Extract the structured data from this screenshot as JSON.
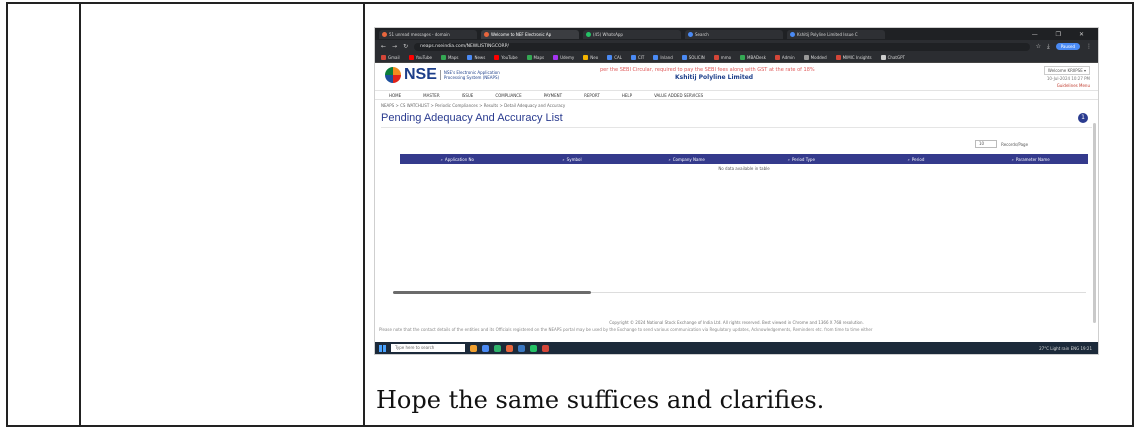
{
  "caption": "Hope the same suffices and clarifies.",
  "browser": {
    "tabs": [
      {
        "label": "51 unread messages - domain",
        "icon_color": "#e8663d",
        "active": false
      },
      {
        "label": "Welcome to NEF Electronic Ap",
        "icon_color": "#e8663d",
        "active": true
      },
      {
        "label": "(45) WhatsApp",
        "icon_color": "#25c266",
        "active": false
      },
      {
        "label": "Search",
        "icon_color": "#4a8af4",
        "active": false
      },
      {
        "label": "Kshitij Polyline Limited Issue C",
        "icon_color": "#4a8af4",
        "active": false
      }
    ],
    "window_controls": "— ❐ ✕",
    "url": "neaps.nseindia.com/NEWLISTINGCORP/",
    "profile_label": "Paused",
    "bookmarks": [
      {
        "label": "Gmail",
        "color": "#d44638"
      },
      {
        "label": "YouTube",
        "color": "#ff0000"
      },
      {
        "label": "Maps",
        "color": "#34a853"
      },
      {
        "label": "News",
        "color": "#4a8af4"
      },
      {
        "label": "YouTube",
        "color": "#ff0000"
      },
      {
        "label": "Maps",
        "color": "#34a853"
      },
      {
        "label": "Udemy",
        "color": "#a435f0"
      },
      {
        "label": "Neo",
        "color": "#f4b400"
      },
      {
        "label": "CAL",
        "color": "#4a8af4"
      },
      {
        "label": "CIT",
        "color": "#4a8af4"
      },
      {
        "label": "Inland",
        "color": "#4a8af4"
      },
      {
        "label": "SOLICIN",
        "color": "#4a8af4"
      },
      {
        "label": "mmo",
        "color": "#d44638"
      },
      {
        "label": "MBADesk",
        "color": "#34a853"
      },
      {
        "label": "Admin",
        "color": "#d44638"
      },
      {
        "label": "Modded",
        "color": "#999999"
      },
      {
        "label": "MIMIC Insights",
        "color": "#d44638"
      },
      {
        "label": "ChatGPT",
        "color": "#cccccc"
      }
    ]
  },
  "nse": {
    "logo_text": "NSE",
    "logo_subtitle_1": "NSE's Electronic Application",
    "logo_subtitle_2": "Processing System (NEAPS)",
    "marquee": "per the SEBI Circular, required to pay the SEBI fees along with GST at the rate of 18%",
    "company_name": "Kshitij Polyline Limited",
    "welcome": "Welcome KRIIPSE ▾",
    "datetime": "10-Jul-2024 10:27 PM",
    "guidelines": "Guidelines Menu",
    "menu": [
      "HOME",
      "MASTER",
      "ISSUE",
      "COMPLIANCE",
      "PAYMENT",
      "REPORT",
      "HELP",
      "VALUE ADDED SERVICES"
    ],
    "breadcrumb": "NEAPS > CS WATCHLIST > Periodic Compliances > Results > Detail Adequacy and Accuracy",
    "page_title": "Pending Adequacy And Accuracy List",
    "badge_count": "1",
    "records_value": "10",
    "records_label": "Records/Page",
    "columns": [
      "Application No",
      "Symbol",
      "Company Name",
      "Period Type",
      "Period",
      "Parameter Name"
    ],
    "empty_message": "No data available in table",
    "copyright": "Copyright © 2024 National Stock Exchange of India Ltd. All rights reserved. Best viewed in Chrome and 1366 X 768 resolution.",
    "note": "Please note that the contact details of the entities and its Officials registered on the NEAPS portal may be used by the Exchange to send various communication via Regulatory updates, Acknowledgements, Reminders etc. from time to time either"
  },
  "taskbar": {
    "search_placeholder": "Type here to search",
    "weather": "27°C Light rain",
    "language": "ENG",
    "clock": "19:21"
  }
}
